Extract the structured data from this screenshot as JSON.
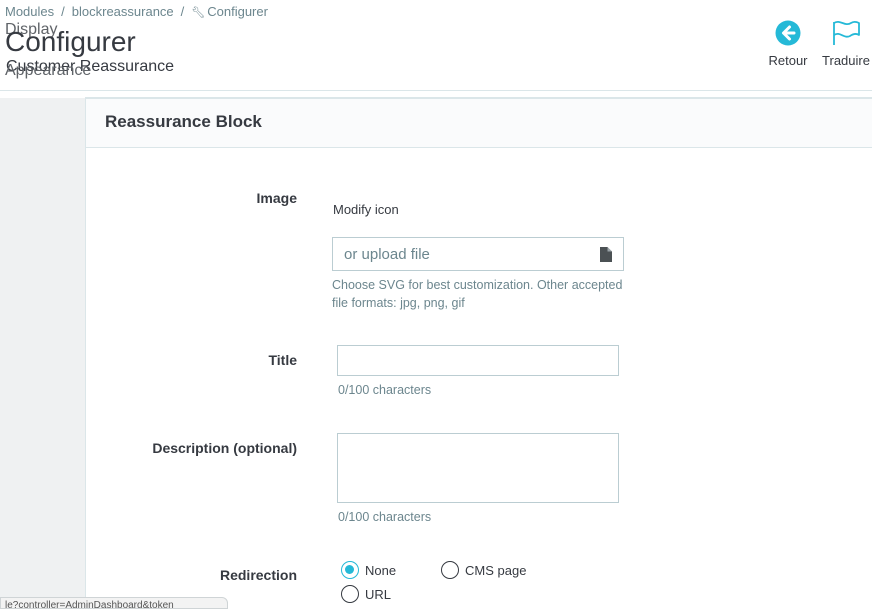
{
  "breadcrumb": {
    "items": [
      "Modules",
      "blockreassurance",
      "Configurer"
    ],
    "separator": "/"
  },
  "header": {
    "overlap_top": "Display",
    "title": "Configurer",
    "subtitle": "Customer Reassurance",
    "overlap_bottom": "Appearance",
    "toolbar": {
      "back_label": "Retour",
      "translate_label": "Traduire"
    }
  },
  "panel": {
    "title": "Reassurance Block"
  },
  "form": {
    "image": {
      "label": "Image",
      "modify_text": "Modify icon",
      "upload_placeholder": "or upload file",
      "help_line1": "Choose SVG for best customization. Other accepted",
      "help_line2": "file formats: jpg, png, gif"
    },
    "title": {
      "label": "Title",
      "value": "",
      "counter": "0/100 characters"
    },
    "description": {
      "label": "Description (optional)",
      "value": "",
      "counter": "0/100 characters"
    },
    "redirection": {
      "label": "Redirection",
      "options": [
        {
          "label": "None",
          "selected": true
        },
        {
          "label": "CMS page",
          "selected": false
        },
        {
          "label": "URL",
          "selected": false
        }
      ]
    }
  },
  "status_bar": {
    "text": "le?controller=AdminDashboard&token"
  },
  "colors": {
    "accent": "#25b9d7",
    "border": "#bbcdd2",
    "text": "#363a41",
    "muted": "#6c868e"
  }
}
